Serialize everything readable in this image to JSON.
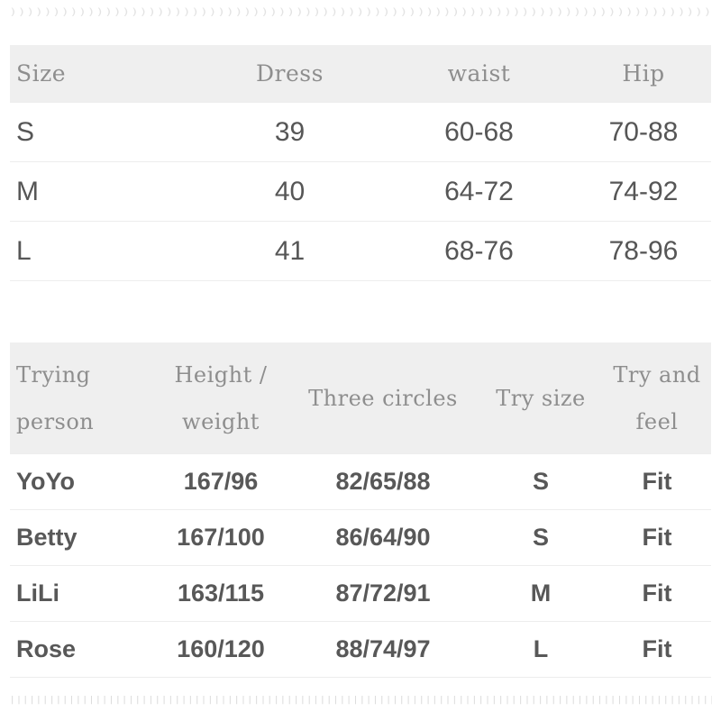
{
  "decoration": {
    "top_edge_pattern": "perforated-tick-strip",
    "bottom_edge_pattern": "perforated-tick-strip",
    "top_ticks": ")))))))))))))))))))))))))))))))))))))))))))))))))))))))))))))))))))))))))))))))))))))))))))))))))))))))))))))))))))))))))))",
    "bottom_ticks": "||||||||||||||||||||||||||||||||||||||||||||||||||||||||||||||||||||||||||||||||||||||||||||||||||||||||||||||||||||||||||||||||||||||||||||||||||||||||||||||||||||||||||||||||||||||||||||||||||||||"
  },
  "colors": {
    "page_background": "#ffffff",
    "header_background": "#efefef",
    "header_text": "#8e8e8e",
    "body_text": "#565656",
    "row_divider": "#ededed",
    "edge_tick": "#e0e0e0"
  },
  "size_table": {
    "name": "size-chart",
    "headers": [
      "Size",
      "Dress",
      "waist",
      "Hip"
    ],
    "rows": [
      {
        "size": "S",
        "dress": "39",
        "waist": "60-68",
        "hip": "70-88"
      },
      {
        "size": "M",
        "dress": "40",
        "waist": "64-72",
        "hip": "74-92"
      },
      {
        "size": "L",
        "dress": "41",
        "waist": "68-76",
        "hip": "78-96"
      }
    ]
  },
  "fit_table": {
    "name": "try-on-reference-chart",
    "headers": [
      "Trying person",
      "Height / weight",
      "Three circles",
      "Try size",
      "Try and feel"
    ],
    "headers_line1": [
      "Trying",
      "Height /",
      "Three circles",
      "Try size",
      "Try and"
    ],
    "headers_line2": [
      "person",
      "weight",
      "",
      "",
      "feel"
    ],
    "rows": [
      {
        "person": "YoYo",
        "height_weight": "167/96",
        "three_circles": "82/65/88",
        "try_size": "S",
        "feel": "Fit"
      },
      {
        "person": "Betty",
        "height_weight": "167/100",
        "three_circles": "86/64/90",
        "try_size": "S",
        "feel": "Fit"
      },
      {
        "person": "LiLi",
        "height_weight": "163/115",
        "three_circles": "87/72/91",
        "try_size": "M",
        "feel": "Fit"
      },
      {
        "person": "Rose",
        "height_weight": "160/120",
        "three_circles": "88/74/97",
        "try_size": "L",
        "feel": "Fit"
      }
    ]
  }
}
